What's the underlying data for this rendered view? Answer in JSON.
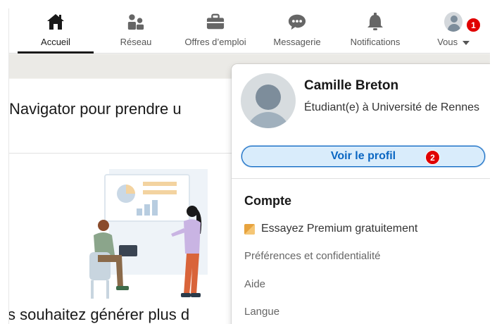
{
  "nav": {
    "items": [
      {
        "label": "Accueil",
        "icon": "home-icon"
      },
      {
        "label": "Réseau",
        "icon": "network-icon"
      },
      {
        "label": "Offres d’emploi",
        "icon": "briefcase-icon"
      },
      {
        "label": "Messagerie",
        "icon": "message-icon"
      },
      {
        "label": "Notifications",
        "icon": "bell-icon"
      },
      {
        "label": "Vous",
        "icon": "avatar"
      }
    ],
    "active": "Accueil"
  },
  "badges": {
    "step1": "1",
    "step2": "2"
  },
  "page": {
    "card_title": "Navigator pour prendre u",
    "card_bottom": "s souhaitez générer plus d"
  },
  "dropdown": {
    "name": "Camille Breton",
    "headline": "Étudiant(e) à Université de Rennes",
    "view_profile": "Voir le profil",
    "account_title": "Compte",
    "premium": "Essayez Premium gratuitement",
    "links": [
      "Préférences et confidentialité",
      "Aide",
      "Langue"
    ]
  },
  "colors": {
    "accent": "#0a66c2",
    "badge": "#e00000",
    "premium": "#e7a33e"
  }
}
